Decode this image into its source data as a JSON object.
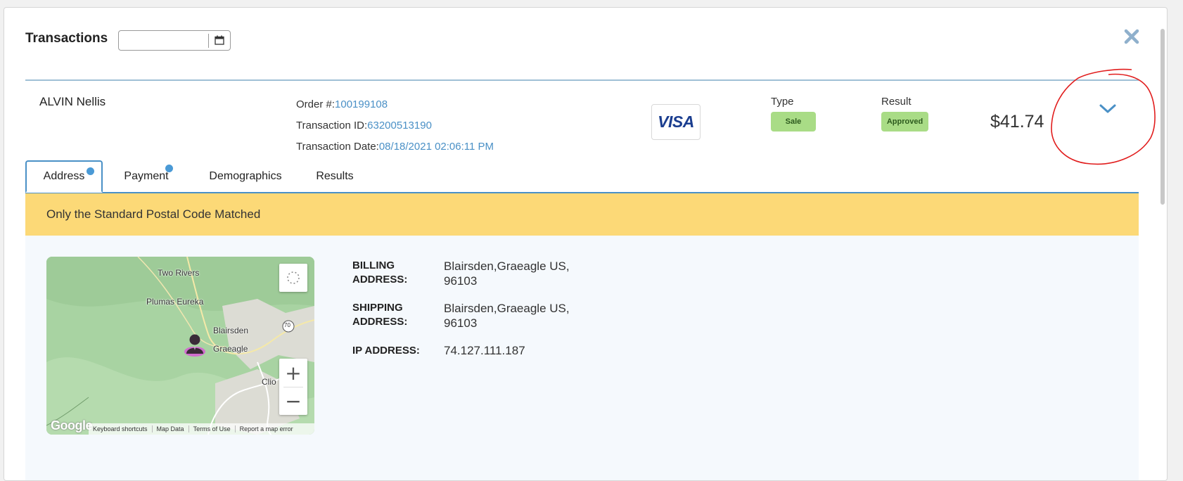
{
  "header": {
    "title": "Transactions",
    "date_value": "",
    "date_icon": "calendar-icon",
    "close_icon": "close-icon"
  },
  "transaction": {
    "customer_name": "ALVIN Nellis",
    "order_label": "Order #:",
    "order_value": "100199108",
    "transaction_id_label": "Transaction ID:",
    "transaction_id_value": "63200513190",
    "transaction_date_label": "Transaction Date:",
    "transaction_date_value": "08/18/2021 02:06:11 PM",
    "card_brand": "VISA",
    "type_label": "Type",
    "type_value": "Sale",
    "result_label": "Result",
    "result_value": "Approved",
    "amount": "$41.74",
    "expand_icon": "chevron-down-icon"
  },
  "tabs": [
    {
      "label": "Address",
      "active": true,
      "has_dot": true
    },
    {
      "label": "Payment",
      "active": false,
      "has_dot": true
    },
    {
      "label": "Demographics",
      "active": false,
      "has_dot": false
    },
    {
      "label": "Results",
      "active": false,
      "has_dot": false
    }
  ],
  "banner": {
    "text": "Only the Standard Postal Code Matched",
    "color": "#fcd977"
  },
  "map": {
    "labels": [
      "Two Rivers",
      "Plumas Eureka",
      "Blairsden",
      "Graeagle",
      "Clio",
      "70"
    ],
    "zoom_in": "+",
    "zoom_out": "−",
    "logo": "Google",
    "footer": [
      "Keyboard shortcuts",
      "Map Data",
      "Terms of Use",
      "Report a map error"
    ],
    "pin_icon": "person-pin-icon",
    "fullscreen_icon": "fullscreen-icon"
  },
  "addresses": {
    "billing_label_1": "BILLING",
    "billing_label_2": "ADDRESS:",
    "billing_line_1": "Blairsden,Graeagle US,",
    "billing_line_2": "96103",
    "shipping_label_1": "SHIPPING",
    "shipping_label_2": "ADDRESS:",
    "shipping_line_1": "Blairsden,Graeagle US,",
    "shipping_line_2": "96103",
    "ip_label": "IP ADDRESS:",
    "ip_value": "74.127.111.187"
  },
  "colors": {
    "accent": "#4a90c6",
    "approved_pill": "#a9dc86",
    "annotation": "#e11d1d"
  }
}
